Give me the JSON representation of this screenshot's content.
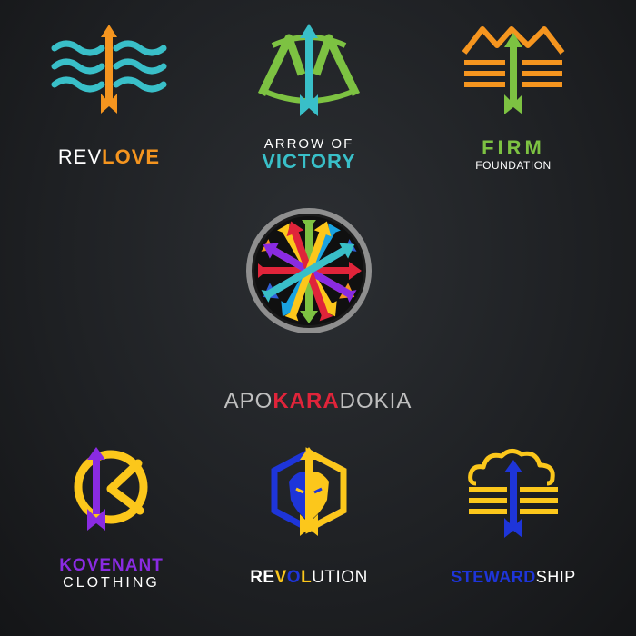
{
  "colors": {
    "teal": "#39bfc8",
    "orange": "#f5951f",
    "green": "#7dc242",
    "red": "#e0243a",
    "gray": "#bfbfbf",
    "purple": "#8a2be2",
    "yellow": "#fcc71b",
    "blue": "#1e35d9",
    "white": "#ffffff"
  },
  "logos": [
    {
      "id": "revlove",
      "parts": [
        "REV",
        "LOVE"
      ]
    },
    {
      "id": "arrow_of_victory",
      "parts": [
        "ARROW OF",
        "VICTORY"
      ]
    },
    {
      "id": "firm_foundation",
      "parts": [
        "FIRM",
        "FOUNDATION"
      ]
    },
    {
      "id": "apokaradokia",
      "parts": [
        "APO",
        "KARA",
        "DOKIA"
      ]
    },
    {
      "id": "kovenant",
      "parts": [
        "KOVENANT",
        "CLOTHING"
      ]
    },
    {
      "id": "revolution",
      "parts": [
        "RE",
        "V",
        "O",
        "L",
        "UTION"
      ]
    },
    {
      "id": "stewardship",
      "parts": [
        "STEWARD",
        "SHIP"
      ]
    }
  ]
}
